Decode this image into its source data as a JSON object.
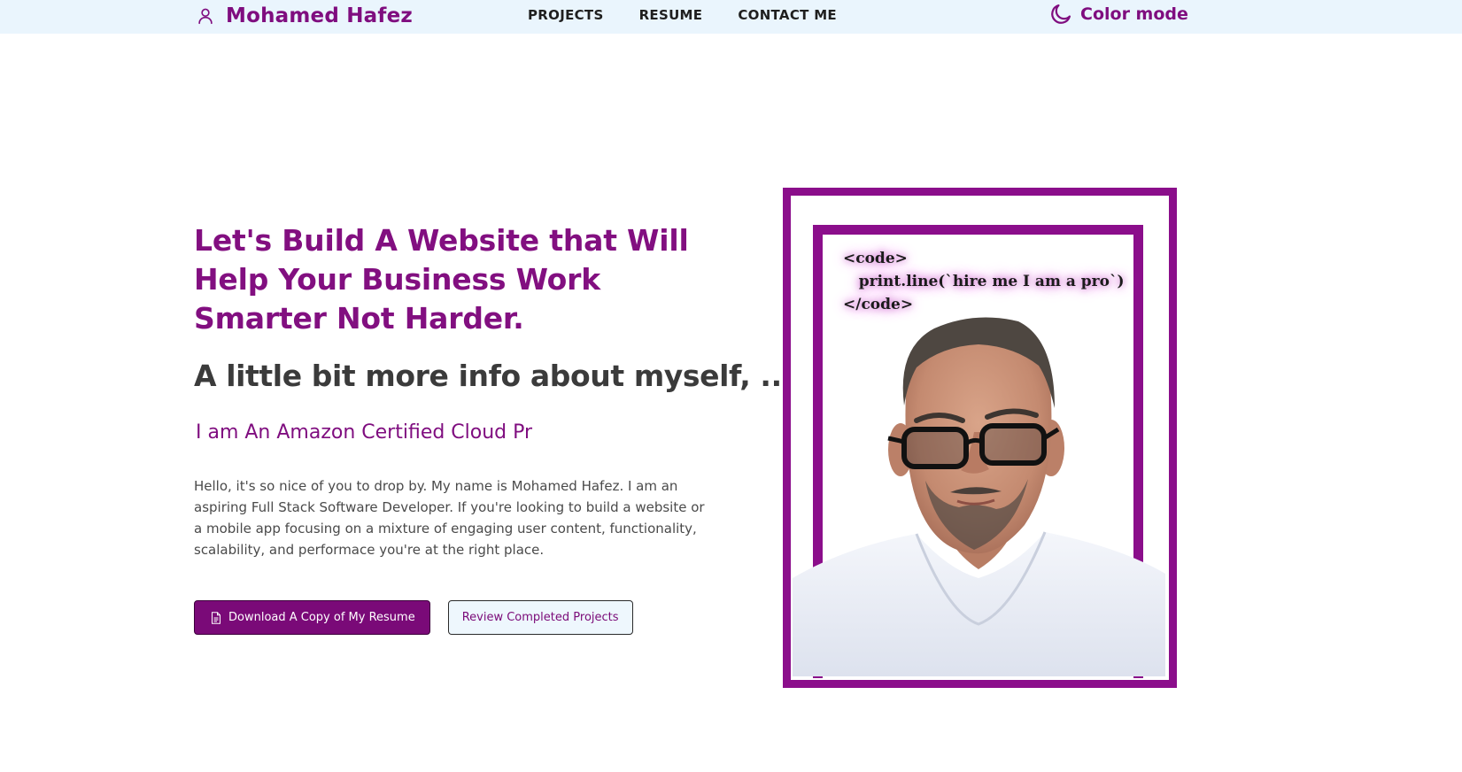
{
  "navbar": {
    "brand_name": "Mohamed Hafez",
    "brand_icon": "user-icon",
    "links": [
      {
        "label": "PROJECTS"
      },
      {
        "label": "RESUME"
      },
      {
        "label": "CONTACT ME"
      }
    ],
    "color_mode_label": "Color mode",
    "color_mode_icon": "moon-icon"
  },
  "hero": {
    "headline": "Let's Build A Website that Will Help Your Business Work Smarter Not Harder.",
    "subheadline": "A little bit more info about myself, ...",
    "typewriter_text": "I am An Amazon Certified Cloud Pr",
    "intro": "Hello, it's so nice of you to drop by. My name is Mohamed Hafez. I am an aspiring Full Stack Software Developer. If you're looking to build a website or a mobile app focusing on a mixture of engaging user content, functionality, scalability, and performace you're at the right place.",
    "primary_button": {
      "label": "Download A Copy of My Resume",
      "icon": "document-icon"
    },
    "secondary_button": {
      "label": "Review Completed Projects"
    }
  },
  "portrait": {
    "code_lines": [
      "<code>",
      "   print.line(`hire me I am a pro`)",
      "</code>"
    ]
  },
  "colors": {
    "brand": "#7f0d7f",
    "navbar_bg": "#eaf5fd",
    "frame": "#8b0e8b",
    "primary_button_bg": "#7a0a78"
  }
}
